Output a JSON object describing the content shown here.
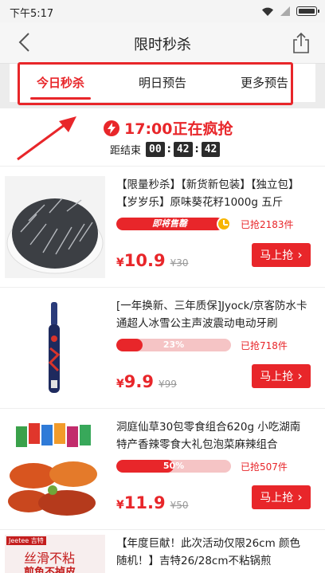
{
  "status_bar": {
    "time": "下午5:17"
  },
  "header": {
    "title": "限时秒杀"
  },
  "tabs": [
    {
      "label": "今日秒杀",
      "active": true
    },
    {
      "label": "明日预告",
      "active": false
    },
    {
      "label": "更多预告",
      "active": false
    }
  ],
  "session": {
    "label": "17:00正在疯抢",
    "countdown_label": "距结束",
    "hours": "00",
    "minutes": "42",
    "seconds": "42"
  },
  "products": [
    {
      "name": "【限量秒杀】【新货新包装】【独立包】【岁岁乐】原味葵花籽1000g 五斤",
      "progress_label": "即将售罄",
      "progress": 0.93,
      "sold": "已抢2183件",
      "currency": "¥",
      "price": "10.9",
      "old_price": "¥30",
      "buy_label": "马上抢"
    },
    {
      "name": "[一年换新、三年质保]Jyock/京客防水卡通超人冰雪公主声波震动电动牙刷",
      "progress_label": "23%",
      "progress": 0.23,
      "sold": "已抢718件",
      "currency": "¥",
      "price": "9.9",
      "old_price": "¥99",
      "buy_label": "马上抢"
    },
    {
      "name": "洞庭仙草30包零食组合620g 小吃湖南特产香辣零食大礼包泡菜麻辣组合",
      "progress_label": "50%",
      "progress": 0.5,
      "sold": "已抢507件",
      "currency": "¥",
      "price": "11.9",
      "old_price": "¥50",
      "buy_label": "马上抢"
    }
  ],
  "partial_product": {
    "name": "【年度巨献！此次活动仅限26cm 颜色随机！】吉特26/28cm不粘锅煎",
    "image_brand": "Jeetee 吉特",
    "image_line1": "丝滑不粘",
    "image_line2": "煎鱼不掉皮"
  },
  "colors": {
    "accent": "#e8262a",
    "progress_bg": "#f5c4c5",
    "clock": "#f7b500"
  }
}
